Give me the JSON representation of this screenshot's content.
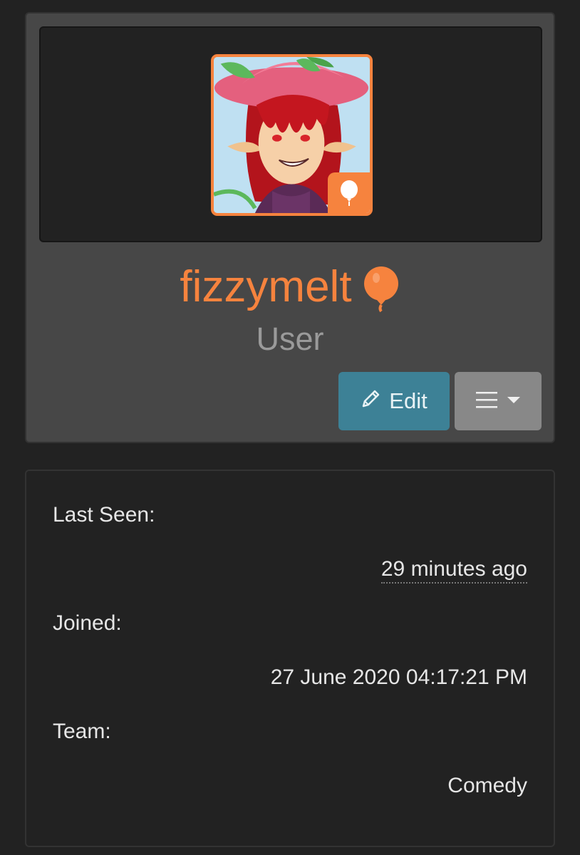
{
  "profile": {
    "username": "fizzymelt",
    "role": "User",
    "avatar_icon": "user-avatar-illustration",
    "badge_icon": "balloon-icon",
    "username_icon": "balloon-icon",
    "accent_color": "#f6833e"
  },
  "actions": {
    "edit_label": "Edit",
    "edit_icon": "pencil-icon",
    "menu_icon": "hamburger-icon",
    "menu_caret_icon": "caret-down-icon"
  },
  "info": {
    "last_seen_label": "Last Seen:",
    "last_seen_value": "29 minutes ago",
    "joined_label": "Joined:",
    "joined_value": "27 June 2020 04:17:21 PM",
    "team_label": "Team:",
    "team_value": "Comedy"
  }
}
